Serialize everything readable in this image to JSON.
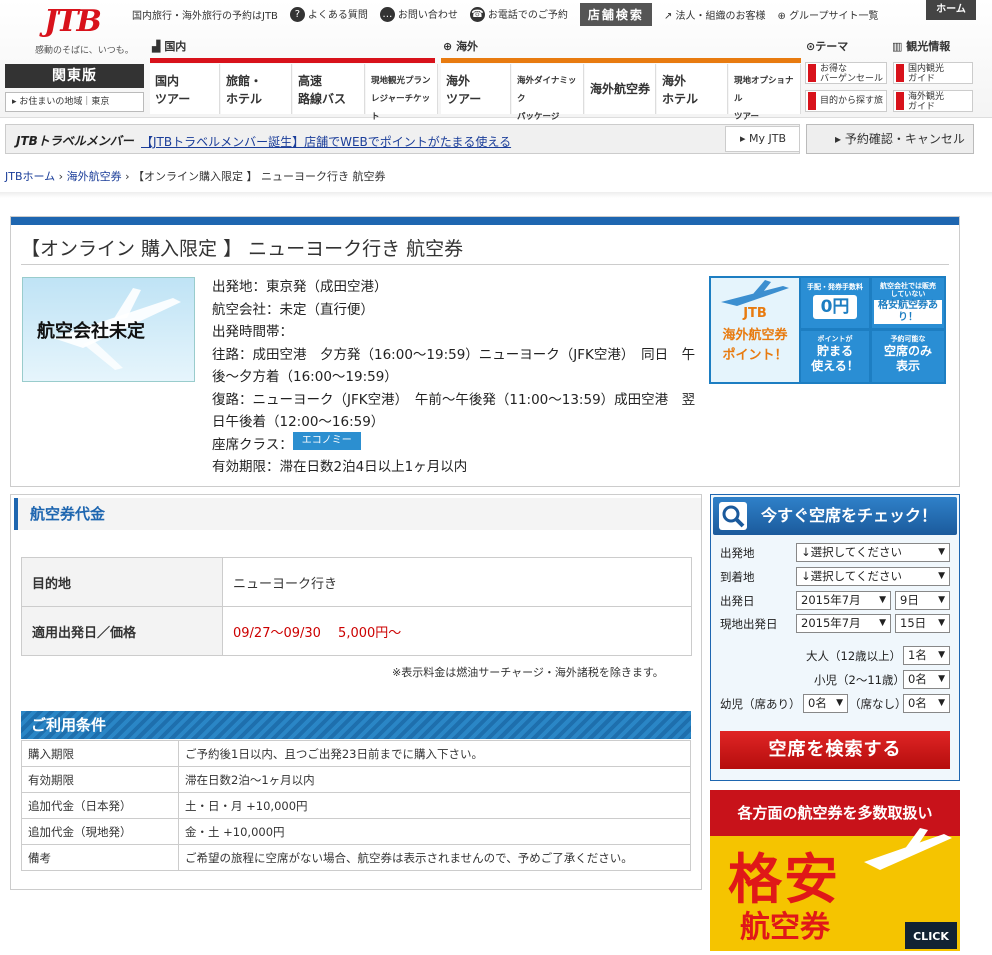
{
  "header": {
    "logo": "JTB",
    "logo_sub": "感動のそばに、いつも。",
    "tagline": "国内旅行・海外旅行の予約はJTB",
    "faq": "よくある質問",
    "contact": "お問い合わせ",
    "phone": "お電話でのご予約",
    "shop_search": "店舗検索",
    "corporate": "法人・組織のお客様",
    "group": "グループサイト一覧",
    "home": "ホーム",
    "region": "関東版",
    "region_sub": "お住まいの地域｜東京",
    "domestic": "国内",
    "international": "海外",
    "theme": "テーマ",
    "sightseeing": "観光情報"
  },
  "nav": {
    "dom_tour": "国内\nツアー",
    "dom_hotel": "旅館・\nホテル",
    "bus": "高速\n路線バス",
    "ticket": "現地観光プラン\nレジャーチケット",
    "int_tour": "海外\nツアー",
    "dynamic": "海外ダイナミック\nパッケージ",
    "air": "海外航空券",
    "int_hotel": "海外\nホテル",
    "optional": "現地オプショナル\nツアー",
    "bargain": "お得な\nバーゲンセール",
    "purpose": "目的から探す旅",
    "dom_guide": "国内観光\nガイド",
    "int_guide": "海外観光\nガイド"
  },
  "member": {
    "logo": "JTBトラベルメンバー",
    "link": "【JTBトラベルメンバー誕生】店舗でWEBでポイントがたまる使える",
    "myjtb": "My JTB",
    "reservation": "予約確認・キャンセル"
  },
  "breadcrumb": {
    "home": "JTBホーム",
    "air": "海外航空券",
    "current": "【オンライン購入限定 】 ニューヨーク行き 航空券"
  },
  "main": {
    "title": "【オンライン 購入限定 】 ニューヨーク行き 航空券",
    "image_label": "航空会社未定",
    "departure": "出発地：東京発（成田空港）",
    "airline": "航空会社：未定（直行便）",
    "time_label": "出発時間帯：",
    "outbound": "往路：成田空港　夕方発（16:00～19:59）ニューヨーク（JFK空港）　同日　午後～夕方着（16:00～19:59）",
    "return": "復路：ニューヨーク（JFK空港）　午前～午後発（11:00～13:59）成田空港　翌日午後着（12:00～16:59）",
    "seat_label": "座席クラス：",
    "seat_class": "エコノミー",
    "validity": "有効期限：滞在日数2泊4日以上1ヶ月以内"
  },
  "points": {
    "title1": "JTB",
    "title2": "海外航空券\nポイント！",
    "fee_label": "手配・発券手数料",
    "fee_value": "0円",
    "cheap_note": "航空会社では販売していない",
    "cheap": "格安航空券あり！",
    "points_label": "ポイントが",
    "points": "貯まる\n使える！",
    "seat_note": "予約可能な",
    "seat_only": "空席のみ\n表示"
  },
  "price": {
    "heading": "航空券代金",
    "dest_label": "目的地",
    "dest_value": "ニューヨーク行き",
    "date_label": "適用出発日／価格",
    "date_value": "09/27～09/30　 5,000円～",
    "note": "※表示料金は燃油サーチャージ・海外諸税を除きます。"
  },
  "conditions": {
    "heading": "ご利用条件",
    "rows": [
      {
        "label": "購入期限",
        "value": "ご予約後1日以内、且つご出発23日前までに購入下さい。"
      },
      {
        "label": "有効期限",
        "value": "滞在日数2泊～1ヶ月以内"
      },
      {
        "label": "追加代金（日本発）",
        "value": "土・日・月 +10,000円"
      },
      {
        "label": "追加代金（現地発）",
        "value": "金・土 +10,000円"
      },
      {
        "label": "備考",
        "value": "ご希望の旅程に空席がない場合、航空券は表示されませんので、予めご了承ください。"
      }
    ]
  },
  "search": {
    "heading": "今すぐ空席をチェック！",
    "from_label": "出発地",
    "from_value": "↓選択してください",
    "to_label": "到着地",
    "to_value": "↓選択してください",
    "date_label": "出発日",
    "date_month": "2015年7月",
    "date_day": "9日",
    "local_label": "現地出発日",
    "local_month": "2015年7月",
    "local_day": "15日",
    "adult_label": "大人（12歳以上）",
    "adult_value": "1名",
    "child_label": "小児（2～11歳）",
    "child_value": "0名",
    "infant_label": "幼児（席あり）",
    "infant_seat": "0名",
    "noseat_label": "（席なし）",
    "infant_noseat": "0名",
    "button": "空席を検索する"
  },
  "banner": {
    "top": "各方面の航空券を多数取扱い",
    "big": "格安",
    "sub": "航空券",
    "click": "CLICK"
  }
}
